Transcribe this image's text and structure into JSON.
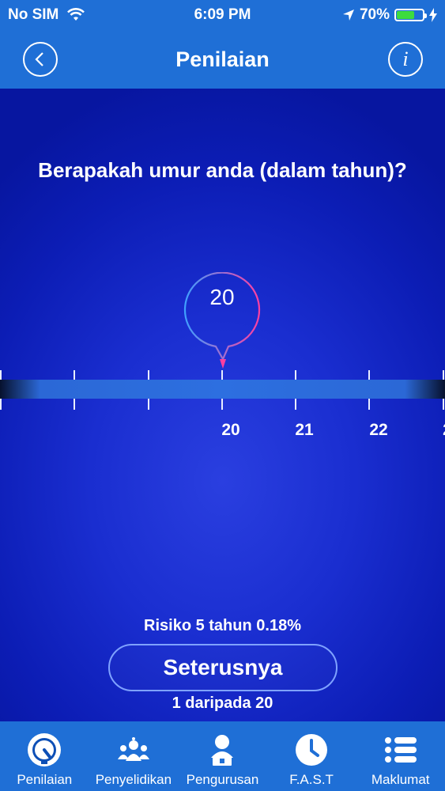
{
  "status_bar": {
    "carrier": "No SIM",
    "time": "6:09 PM",
    "battery_percent": "70%",
    "battery_level": 0.7
  },
  "header": {
    "title": "Penilaian"
  },
  "question": "Berapakah umur anda (dalam tahun)?",
  "slider": {
    "selected_value": "20",
    "tick_labels": [
      "20",
      "21",
      "22",
      "2"
    ]
  },
  "risk_text": "Risiko 5 tahun 0.18%",
  "next_button_label": "Seterusnya",
  "progress_text": "1 daripada 20",
  "tabs": [
    {
      "label": "Penilaian",
      "icon": "gauge-icon",
      "active": true
    },
    {
      "label": "Penyelidikan",
      "icon": "research-group-icon",
      "active": false
    },
    {
      "label": "Pengurusan",
      "icon": "doctor-icon",
      "active": false
    },
    {
      "label": "F.A.S.T",
      "icon": "clock-icon",
      "active": false
    },
    {
      "label": "Maklumat",
      "icon": "list-icon",
      "active": false
    }
  ]
}
